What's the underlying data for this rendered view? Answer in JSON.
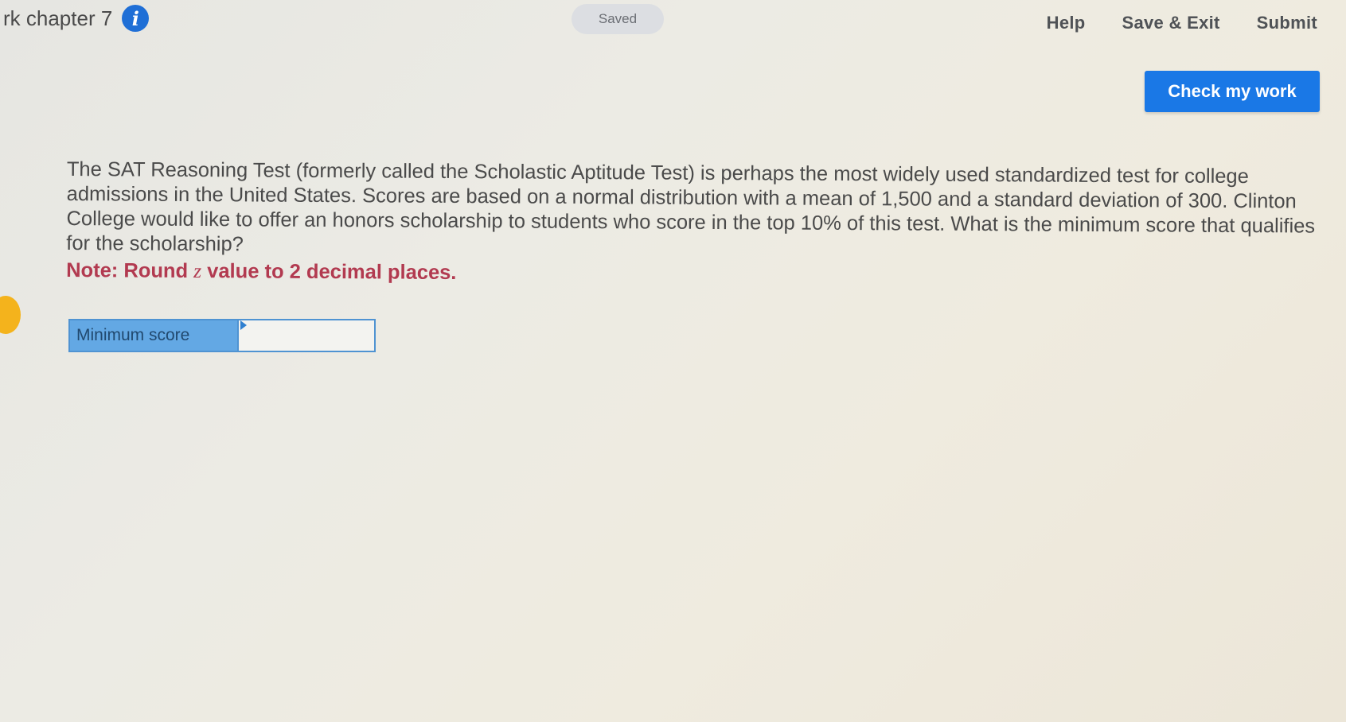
{
  "header": {
    "assignment_title": "rk chapter 7",
    "info_icon": "info-icon",
    "saved_status": "Saved",
    "links": {
      "help": "Help",
      "save_exit": "Save & Exit",
      "submit": "Submit"
    }
  },
  "actions": {
    "check_my_work": "Check my work"
  },
  "question": {
    "text": "The SAT Reasoning Test (formerly called the Scholastic Aptitude Test) is perhaps the most widely used standardized test for college admissions in the United States. Scores are based on a normal distribution with a mean of 1,500 and a standard deviation of 300. Clinton College would like to offer an honors scholarship to students who score in the top 10% of this test. What is the minimum score that qualifies for the scholarship?",
    "note_prefix": "Note: Round ",
    "note_var": "z",
    "note_suffix": " value to 2 decimal places."
  },
  "answer": {
    "label": "Minimum score",
    "value": "",
    "placeholder": ""
  },
  "colors": {
    "primary_button": "#1a78e6",
    "info_icon": "#1f6fd6",
    "note_text": "#b23a50",
    "answer_label_bg": "#63a8e4",
    "side_marker": "#f4b31c"
  }
}
